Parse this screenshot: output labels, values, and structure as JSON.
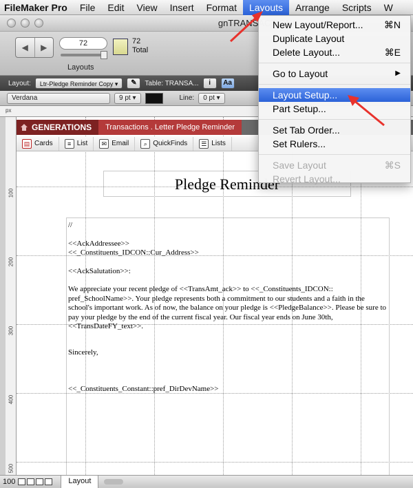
{
  "menubar": {
    "app": "FileMaker Pro",
    "items": [
      "File",
      "Edit",
      "View",
      "Insert",
      "Format",
      "Layouts",
      "Arrange",
      "Scripts",
      "W"
    ],
    "active_index": 5
  },
  "window": {
    "title": "gnTRANSACTIONS",
    "record_field": "72",
    "layouts_label": "Layouts",
    "total_count": "72",
    "total_label": "Total"
  },
  "layoutbar": {
    "layout_label": "Layout:",
    "layout_value": "Ltr-Pledge Reminder Copy",
    "table_label": "Table: TRANSA..."
  },
  "formatbar": {
    "font": "Verdana",
    "size": "9 pt",
    "line_label": "Line:",
    "line_value": "0 pt"
  },
  "ruler": {
    "unit": "px",
    "vticks": [
      "100",
      "200",
      "300",
      "400",
      "500"
    ]
  },
  "header": {
    "brand": "GENERATIONS",
    "crumb": "Transactions . Letter Pledge Reminder"
  },
  "nav": [
    {
      "label": "Cards",
      "icon": "cards-icon"
    },
    {
      "label": "List",
      "icon": "list-icon"
    },
    {
      "label": "Email",
      "icon": "email-icon"
    },
    {
      "label": "QuickFinds",
      "icon": "magnifier-icon"
    },
    {
      "label": "Lists",
      "icon": "lists-icon"
    }
  ],
  "document": {
    "title": "Pledge Reminder",
    "lines": {
      "l1": "//",
      "l2": "<<AckAddressee>>",
      "l3": "<<_Constituents_IDCON::Cur_Address>>",
      "l4": "<<AckSalutation>>:",
      "body": "We appreciate your recent pledge of <<TransAmt_ack>> to <<_Constituents_IDCON:: pref_SchoolName>>. Your pledge represents both a commitment to our students and a faith in the school's important work. As of now, the balance on your pledge is <<PledgeBalance>>. Please be sure to pay your pledge by the end of the current fiscal year. Our fiscal year ends on June 30th, <<TransDateFY_text>>.",
      "closing": "Sincerely,",
      "signature": "<<_Constituents_Constant::pref_DirDevName>>"
    }
  },
  "bottombar": {
    "zoom": "100",
    "mode": "Layout"
  },
  "layouts_menu": {
    "items": [
      {
        "label": "New Layout/Report...",
        "shortcut": "⌘N"
      },
      {
        "label": "Duplicate Layout",
        "shortcut": ""
      },
      {
        "label": "Delete Layout...",
        "shortcut": "⌘E"
      },
      {
        "label": "Go to Layout",
        "shortcut": "▶"
      },
      {
        "label": "Layout Setup...",
        "shortcut": ""
      },
      {
        "label": "Part Setup...",
        "shortcut": ""
      },
      {
        "label": "Set Tab Order...",
        "shortcut": ""
      },
      {
        "label": "Set Rulers...",
        "shortcut": ""
      },
      {
        "label": "Save Layout",
        "shortcut": "⌘S"
      },
      {
        "label": "Revert Layout...",
        "shortcut": ""
      }
    ]
  },
  "colors": {
    "accent": "#2b62d8",
    "arrow": "#e8322c",
    "brand": "#7d2222"
  }
}
